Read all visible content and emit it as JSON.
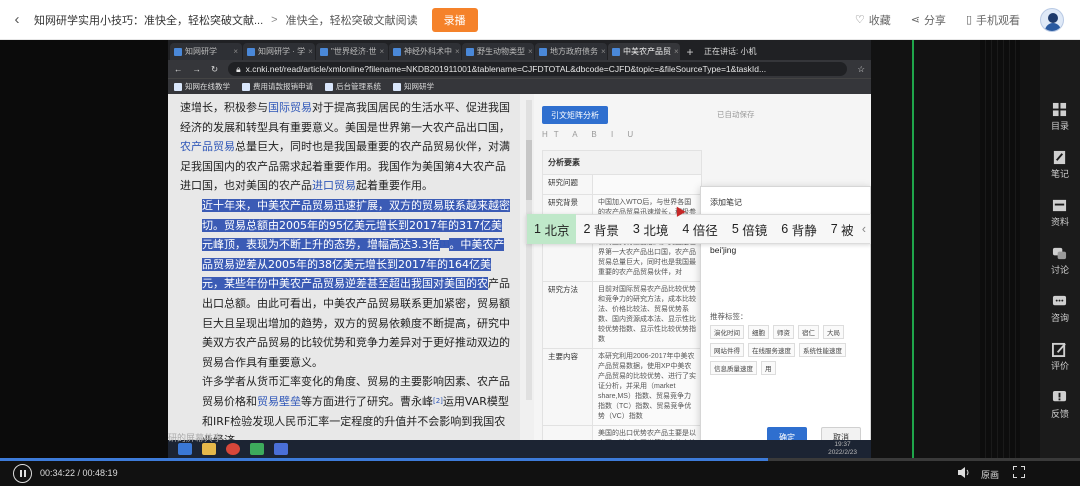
{
  "header": {
    "back_icon": "back-arrow-icon",
    "course_title": "知网研学实用小技巧：准快全，轻松突破文献...",
    "separator": ">",
    "lesson_title": "准快全，轻松突破文献阅读",
    "live_button": "录播",
    "actions": [
      {
        "icon": "heart-icon",
        "label": "收藏"
      },
      {
        "icon": "share-icon",
        "label": "分享"
      },
      {
        "icon": "phone-icon",
        "label": "手机观看"
      }
    ]
  },
  "browser": {
    "tabs": [
      {
        "label": "知网研学"
      },
      {
        "label": "知网研学 · 学"
      },
      {
        "label": "\"世界经济·世"
      },
      {
        "label": "神经外科术中"
      },
      {
        "label": "野生动物类型"
      },
      {
        "label": "地方政府债务"
      },
      {
        "label": "中美农产品贸",
        "active": true
      }
    ],
    "new_tab": "+",
    "sharing_notice": "正在讲话: 小机",
    "url": "x.cnki.net/read/article/xmlonline?filename=NKDB201911001&tablename=CJFDTOTAL&dbcode=CJFD&topic=&fileSourceType=1&taskId...",
    "bookmarks": [
      "知网在线教学",
      "费用请款报销申请",
      "后台管理系统",
      "知网研学"
    ]
  },
  "article": {
    "p1": {
      "t1": "速增长，积极参与",
      "link1": "国际贸易",
      "t2": "对于提高我国居民的生活水平、促进我国经济的发展和转型具有重要意义。美国是世界第一大农产品出口国，",
      "link2": "农产品贸易",
      "t3": "总量巨大，同时也是我国最重要的农产品贸易伙伴，对满足我国国内的农产品需求起着重要作用。我国作为美国第4大农产品进口国，也对美国的农产品",
      "link3": "进口贸易",
      "t4": "起着重要作用。"
    },
    "p2": {
      "highlighted": "近十年来，中美农产品贸易迅速扩展，双方的贸易联系越来越密切。贸易总额由2005年的95亿美元增长到2017年的317亿美元峰顶，表现为不断上升的态势，增幅高达3.3倍",
      "sup": "[1]",
      "highlighted2": "。中美农产品贸易逆差从2005年的38亿美元增长到2017年的164亿美元，某些年份中美农产品贸易逆差甚至超出我国对美国的农",
      "rest": "产品出口总额。由此可看出，中美农产品贸易联系更加紧密，贸易额巨大且呈现出增加的趋势，双方的贸易依赖度不断提高，研究中美双方农产品贸易的比较优势和竞争力差异对于更好推动双边的贸易合作具有重要意义。"
    },
    "p3": {
      "t1": "许多学者从货币汇率变化的角度、贸易的主要影响因素、农产品贸易价格和",
      "link1": "贸易壁垒",
      "t2": "等方面进行了研究。曹永峰",
      "sup": "[2]",
      "t3": "运用VAR模型和IRF检验发现人民币汇率一定程度的升值并不会影响到我国农业经济"
    }
  },
  "analysis": {
    "button": "引文矩阵分析",
    "saved": "已自动保存",
    "header": "分析要素",
    "rows": [
      {
        "key": "研究问题",
        "value": ""
      },
      {
        "key": "研究背景",
        "value": "中国加入WTO后，与世界各国的农产品贸易迅速增长，积极参与国际贸易对于提高我国居民的生活水平、促进我国经济的发展和转型具有重要意义。美国是世界第一大农产品出口国，农产品贸易总量巨大，同时也是我国最重要的农产品贸易伙伴，对"
      },
      {
        "key": "研究方法",
        "value": "目前对国际贸易农产品比较优势和竞争力的研究方法，成本比较法、价格比较法、贸易优势系数、国内资源成本法、显示性比较优势指数、显示性比较优势指数"
      },
      {
        "key": "主要内容",
        "value": "本研究利用2006-2017年中美农产品贸易数据，使用XP中美农产品贸易的比较优势、进行了实证分析，并采用（market share,MS）指数、贸易竞争力指数（TC）指数、贸易竞争优势（VC）指数"
      },
      {
        "key": "",
        "value": "美国的出口优势农产品主要是以大豆、猪肉和玉米等为主的土地密集型资源密集型农产品，美国自身型农产品大多列RCA指数均大于5.0"
      }
    ]
  },
  "note_dialog": {
    "title": "添加笔记",
    "format_tools": [
      "B",
      "I",
      "U",
      "abc",
      "✎",
      "⇌",
      "⚲",
      "▬",
      "Σ"
    ],
    "input_text": "bei'jing",
    "tags_label": "推荐标签：",
    "tags": [
      "演化时间",
      "细胞",
      "师资",
      "宿仁",
      "大局",
      "网站件得",
      "在线服务速度",
      "系统性能速度",
      "信息质量速度",
      "用"
    ],
    "ok": "确定",
    "cancel": "取消"
  },
  "ime": {
    "candidates": [
      {
        "num": "1",
        "word": "北京",
        "selected": true
      },
      {
        "num": "2",
        "word": "背景"
      },
      {
        "num": "3",
        "word": "北境"
      },
      {
        "num": "4",
        "word": "倍径"
      },
      {
        "num": "5",
        "word": "倍镜"
      },
      {
        "num": "6",
        "word": "背静"
      },
      {
        "num": "7",
        "word": "被"
      }
    ],
    "more": "‹"
  },
  "recording": {
    "clock_time": "19:37",
    "clock_date": "2022/2/23",
    "share_label": "研的屏幕共享"
  },
  "sidebar": [
    {
      "icon": "toc-icon",
      "label": "目录"
    },
    {
      "icon": "notes-icon",
      "label": "笔记"
    },
    {
      "icon": "materials-icon",
      "label": "资料"
    },
    {
      "icon": "discussion-icon",
      "label": "讨论"
    },
    {
      "icon": "consult-icon",
      "label": "咨询"
    },
    {
      "icon": "rating-icon",
      "label": "评价"
    },
    {
      "icon": "feedback-icon",
      "label": "反馈"
    }
  ],
  "player": {
    "time": "00:34:22 / 00:48:19",
    "progress": 0.711,
    "quality": "原画"
  }
}
